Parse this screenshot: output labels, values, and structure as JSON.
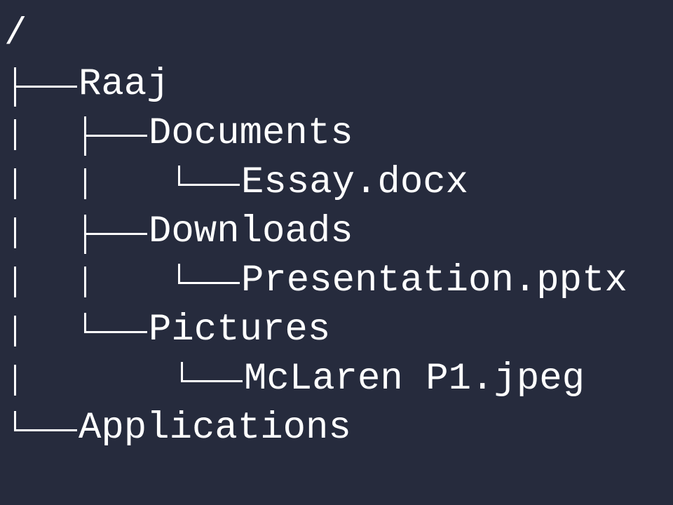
{
  "tree": {
    "root": "/",
    "items": [
      {
        "name": "Raaj"
      },
      {
        "name": "Documents"
      },
      {
        "name": "Essay.docx"
      },
      {
        "name": "Downloads"
      },
      {
        "name": "Presentation.pptx"
      },
      {
        "name": "Pictures"
      },
      {
        "name": "McLaren P1.jpeg"
      },
      {
        "name": "Applications"
      }
    ]
  },
  "colors": {
    "background": "#262b3d",
    "text": "#ffffff"
  }
}
